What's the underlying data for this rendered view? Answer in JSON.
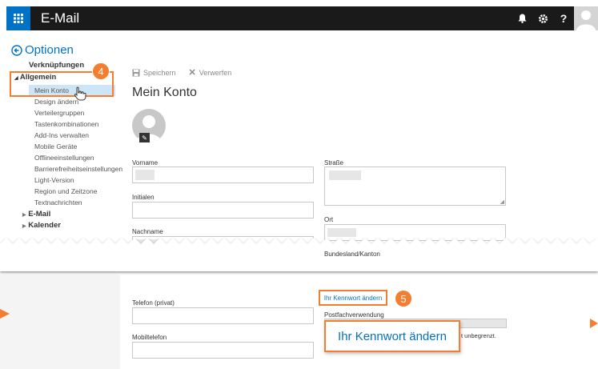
{
  "app": {
    "title": "E-Mail"
  },
  "options": {
    "title": "Optionen"
  },
  "sidebar": {
    "header": "Verknüpfungen",
    "group_general": "Allgemein",
    "general_items": [
      "Mein Konto",
      "Design ändern",
      "Verteilergruppen",
      "Tastenkombinationen",
      "Add-Ins verwalten",
      "Mobile Geräte",
      "Offlineeinstellungen",
      "Barrierefreiheitseinstellungen",
      "Light-Version",
      "Region und Zeitzone",
      "Textnachrichten"
    ],
    "group_email": "E-Mail",
    "group_calendar": "Kalender"
  },
  "toolbar": {
    "save_label": "Speichern",
    "discard_label": "Verwerfen"
  },
  "page": {
    "title": "Mein Konto"
  },
  "form": {
    "vorname_label": "Vorname",
    "initialen_label": "Initialen",
    "nachname_label": "Nachname",
    "strasse_label": "Straße",
    "ort_label": "Ort",
    "bundesland_label": "Bundesland/Kanton",
    "telefon_privat_label": "Telefon (privat)",
    "mobiltelefon_label": "Mobiltelefon",
    "change_password_link": "Ihr Kennwort ändern",
    "mailbox_usage_label": "Postfachverwendung",
    "mailbox_usage_text": "t unbegrenzt."
  },
  "callouts": {
    "step4": "4",
    "step5": "5",
    "zoom_text": "Ihr Kennwort ändern"
  },
  "colors": {
    "accent": "#0072c6",
    "callout": "#f47d30",
    "topbar": "#1a1a1a",
    "selected": "#cde6f7"
  }
}
